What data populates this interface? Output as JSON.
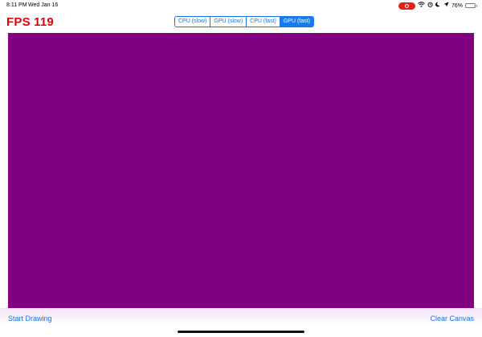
{
  "status_bar": {
    "time": "8:11 PM",
    "date": "Wed Jan 16",
    "battery_percent": "76%",
    "battery_level": 0.76,
    "record_color": "#e0211a",
    "battery_color": "#43c05a"
  },
  "header": {
    "fps_text": "FPS 119",
    "fps_color": "#e0000a"
  },
  "segments": [
    {
      "label": "CPU (slow)",
      "selected": false
    },
    {
      "label": "GPU (slow)",
      "selected": false
    },
    {
      "label": "CPU (fast)",
      "selected": false
    },
    {
      "label": "GPU (fast)",
      "selected": true
    }
  ],
  "canvas": {
    "background_color": "#800080"
  },
  "toolbar": {
    "start_label": "Start Drawing",
    "clear_label": "Clear Canvas"
  },
  "colors": {
    "accent": "#1a73e8"
  }
}
